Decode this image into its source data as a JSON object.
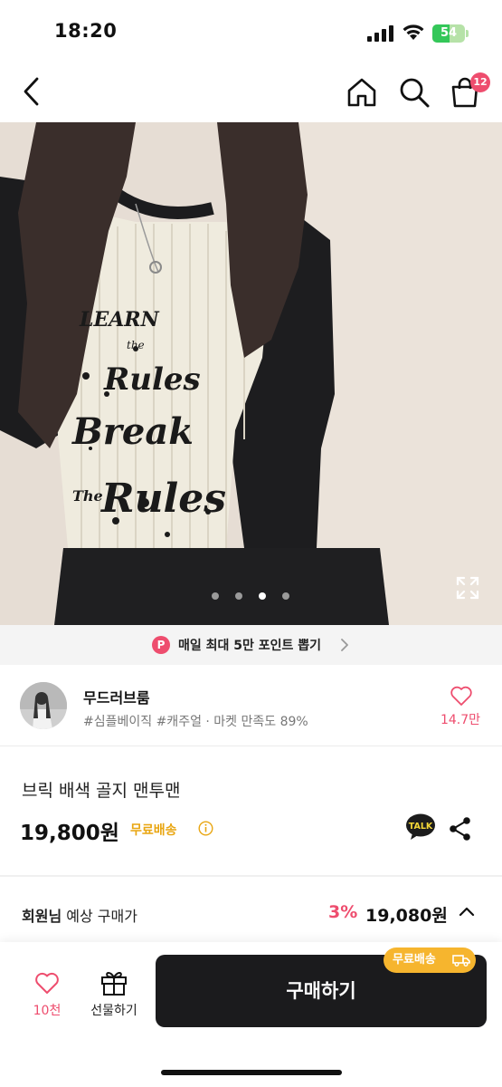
{
  "status_bar": {
    "time": "18:20",
    "battery_percent": 54,
    "battery_label": "54"
  },
  "nav": {
    "icons": [
      "back-icon",
      "home-icon",
      "search-icon",
      "cart-icon"
    ],
    "cart_badge": "12"
  },
  "gallery": {
    "image_count": 4,
    "active_index": 2,
    "shirt_text": [
      "LEARN",
      "the",
      "Rules",
      "Break",
      "The",
      "Rules"
    ],
    "expand_icon": "expand-icon"
  },
  "promo": {
    "badge": "P",
    "text": "매일 최대 5만 포인트 뽑기"
  },
  "shop": {
    "name": "무드러브룸",
    "tags": "#심플베이직 #캐주얼 · 마켓 만족도 89%",
    "like_count": "14.7만"
  },
  "product": {
    "title": "브릭 배색 골지 맨투맨",
    "price": "19,800원",
    "shipping": "무료배송",
    "talk_label": "TALK"
  },
  "member_price": {
    "label_bold": "회원님",
    "label_rest": " 예상 구매가",
    "discount": "3%",
    "price": "19,080원"
  },
  "bottom_bar": {
    "like_count": "10천",
    "gift_label": "선물하기",
    "buy_label": "구매하기",
    "shipping_badge": "무료배송"
  },
  "colors": {
    "accent_pink": "#ee4d6e",
    "shipping_yellow": "#e9a612",
    "buy_button": "#1b1b1d",
    "battery_green": "#34c759"
  }
}
